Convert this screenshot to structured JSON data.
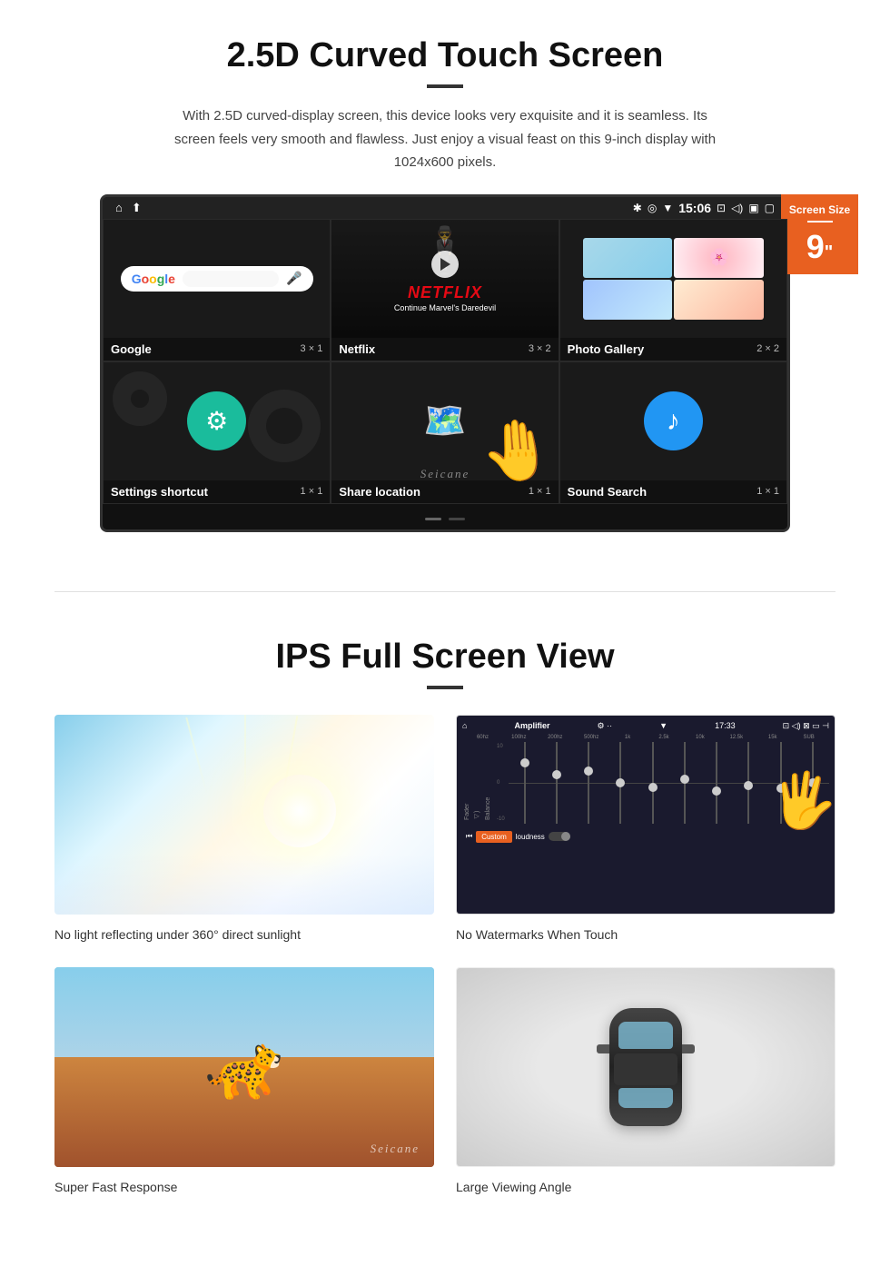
{
  "section1": {
    "title": "2.5D Curved Touch Screen",
    "description": "With 2.5D curved-display screen, this device looks very exquisite and it is seamless. Its screen feels very smooth and flawless. Just enjoy a visual feast on this 9-inch display with 1024x600 pixels.",
    "screen_size_label": "Screen Size",
    "screen_size_value": "9\"",
    "status_bar": {
      "time": "15:06",
      "bluetooth": "✱",
      "location": "◎",
      "signal": "▼",
      "camera": "⊡",
      "volume": "◁)",
      "battery": "▣",
      "window": "▢"
    },
    "apps": [
      {
        "name": "Google",
        "size": "3 × 1",
        "type": "google"
      },
      {
        "name": "Netflix",
        "size": "3 × 2",
        "type": "netflix",
        "netflix_text": "NETFLIX",
        "netflix_sub": "Continue Marvel's Daredevil"
      },
      {
        "name": "Photo Gallery",
        "size": "2 × 2",
        "type": "photos"
      },
      {
        "name": "Settings shortcut",
        "size": "1 × 1",
        "type": "settings"
      },
      {
        "name": "Share location",
        "size": "1 × 1",
        "type": "share"
      },
      {
        "name": "Sound Search",
        "size": "1 × 1",
        "type": "sound"
      }
    ],
    "watermark": "Seicane"
  },
  "section2": {
    "title": "IPS Full Screen View",
    "features": [
      {
        "id": "sunlight",
        "caption": "No light reflecting under 360° direct sunlight",
        "type": "sky"
      },
      {
        "id": "touch",
        "caption": "No Watermarks When Touch",
        "type": "amplifier",
        "amp_title": "Amplifier",
        "amp_time": "17:33",
        "amp_bands": [
          "60hz",
          "100hz",
          "200hz",
          "500hz",
          "1k",
          "2.5k",
          "10k",
          "12.5k",
          "15k",
          "SUB"
        ],
        "amp_labels": [
          "Balance",
          "Fader"
        ],
        "amp_custom": "Custom",
        "amp_loudness": "loudness"
      },
      {
        "id": "response",
        "caption": "Super Fast Response",
        "type": "cheetah"
      },
      {
        "id": "viewing",
        "caption": "Large Viewing Angle",
        "type": "car"
      }
    ],
    "seicane_watermark": "Seicane"
  }
}
